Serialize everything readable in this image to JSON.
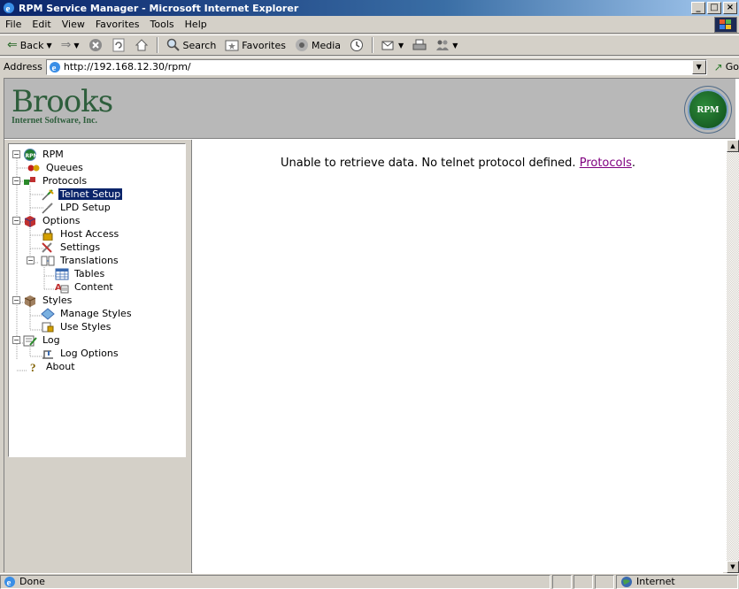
{
  "window": {
    "title": "RPM Service Manager - Microsoft Internet Explorer",
    "buttons": [
      "_",
      "□",
      "×"
    ]
  },
  "menu": [
    "File",
    "Edit",
    "View",
    "Favorites",
    "Tools",
    "Help"
  ],
  "toolbar": {
    "back": "Back",
    "search": "Search",
    "favorites": "Favorites",
    "media": "Media"
  },
  "address": {
    "label": "Address",
    "url": "http://192.168.12.30/rpm/",
    "go": "Go"
  },
  "banner": {
    "brand": "Brooks",
    "subtitle": "Internet Software, Inc.",
    "seal_text": "RPM"
  },
  "tree": {
    "root": "RPM",
    "queues": "Queues",
    "protocols": "Protocols",
    "telnet_setup": "Telnet Setup",
    "lpd_setup": "LPD Setup",
    "options": "Options",
    "host_access": "Host Access",
    "settings": "Settings",
    "translations": "Translations",
    "tables": "Tables",
    "content": "Content",
    "styles": "Styles",
    "manage_styles": "Manage Styles",
    "use_styles": "Use Styles",
    "log": "Log",
    "log_options": "Log Options",
    "about": "About"
  },
  "main": {
    "message": "Unable to retrieve data. No telnet protocol defined.",
    "link": "Protocols",
    "trailing": "."
  },
  "status": {
    "text": "Done",
    "zone": "Internet"
  }
}
